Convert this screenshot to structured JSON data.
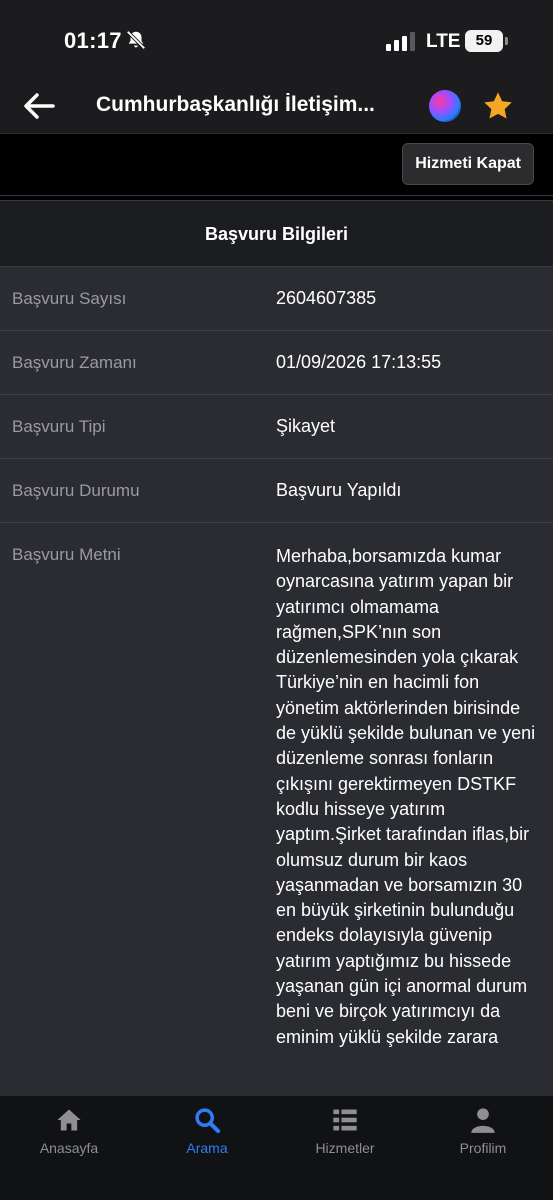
{
  "status_bar": {
    "time": "01:17",
    "network": "LTE",
    "battery": "59",
    "icons": [
      "bell-slash-icon",
      "signal-icon",
      "battery-icon"
    ]
  },
  "header": {
    "title": "Cumhurbaşkanlığı İletişim...",
    "icons": [
      "back-arrow-icon",
      "siri-icon",
      "star-icon"
    ],
    "star_color": "#f5a623"
  },
  "toolbar": {
    "close_service_label": "Hizmeti Kapat"
  },
  "application": {
    "section_title": "Başvuru Bilgileri",
    "fields": [
      {
        "label": "Başvuru Sayısı",
        "value": "2604607385"
      },
      {
        "label": "Başvuru Zamanı",
        "value": "01/09/2026 17:13:55"
      },
      {
        "label": "Başvuru Tipi",
        "value": "Şikayet"
      },
      {
        "label": "Başvuru Durumu",
        "value": "Başvuru Yapıldı"
      },
      {
        "label": "Başvuru Metni",
        "value": "Merhaba,borsamızda kumar oynarcasına yatırım yapan bir yatırımcı olmamama rağmen,SPK’nın son düzenlemesinden yola çıkarak Türkiye’nin en hacimli fon yönetim aktörlerinden birisinde de yüklü şekilde bulunan ve yeni düzenleme sonrası fonların çıkışını gerektirmeyen DSTKF kodlu hisseye yatırım yaptım.Şirket tarafından iflas,bir olumsuz durum bir kaos yaşanmadan ve borsamızın 30 en büyük şirketinin bulunduğu endeks dolayısıyla güvenip yatırım yaptığımız bu hissede yaşanan gün içi anormal durum beni ve birçok yatırımcıyı da eminim yüklü şekilde zarara"
      }
    ]
  },
  "tabbar": {
    "active_color": "#2f7cf6",
    "items": [
      {
        "label": "Anasayfa",
        "icon": "home-icon"
      },
      {
        "label": "Arama",
        "icon": "search-icon"
      },
      {
        "label": "Hizmetler",
        "icon": "services-list-icon"
      },
      {
        "label": "Profilim",
        "icon": "profile-icon"
      }
    ]
  }
}
